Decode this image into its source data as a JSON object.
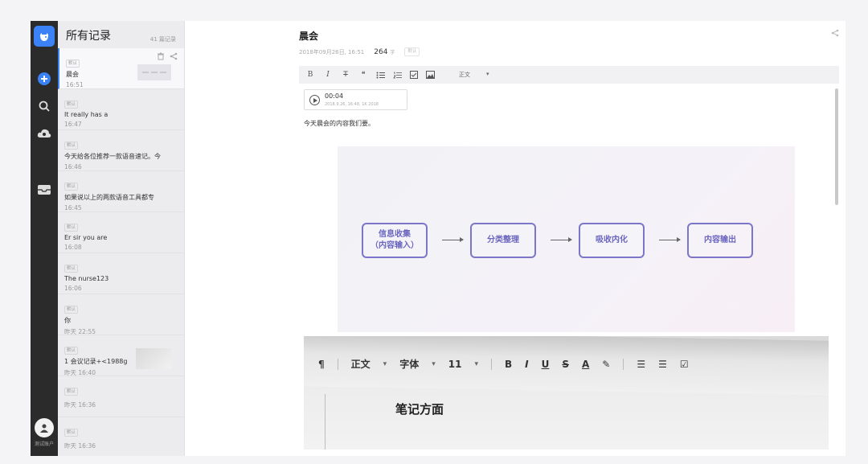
{
  "rail": {
    "avatar_label": "测试账户"
  },
  "list": {
    "title": "所有记录",
    "count": "41 篇记录",
    "items": [
      {
        "tag": "默认",
        "title": "晨会",
        "time": "16:51"
      },
      {
        "tag": "默认",
        "title": "It really has a",
        "time": "16:47"
      },
      {
        "tag": "默认",
        "title": "今天给各位推荐一款语音速记。今",
        "time": "16:46"
      },
      {
        "tag": "默认",
        "title": "如果说以上的两款语音工具都专",
        "time": "16:45"
      },
      {
        "tag": "默认",
        "title": "Er sir you are",
        "time": "16:08"
      },
      {
        "tag": "默认",
        "title": "The nurse123",
        "time": "16:06"
      },
      {
        "tag": "默认",
        "title": "你",
        "time": "昨天 22:55"
      },
      {
        "tag": "默认",
        "title": "1 会议记录+<1988g",
        "time": "昨天 16:40"
      },
      {
        "tag": "默认",
        "title": "",
        "time": "昨天 16:36"
      },
      {
        "tag": "默认",
        "title": "",
        "time": "昨天 16:36"
      }
    ]
  },
  "editor": {
    "title": "晨会",
    "date": "2018年09月26日, 16:51",
    "word_count": "264",
    "word_unit": "字",
    "tag": "默认",
    "toolbar": {
      "bold": "B",
      "italic": "I",
      "strike": "T",
      "quote": "❝",
      "style": "正文",
      "style_caret": "▾"
    },
    "audio": {
      "duration": "00:04",
      "stamp": "2018.9.26, 16:48, 1K 2018"
    },
    "paragraph": "今天晨会的内容我们要。",
    "flow": [
      "信息收集\n（内容输入）",
      "分类整理",
      "吸收内化",
      "内容输出"
    ],
    "photo": {
      "style": "正文",
      "font": "字体",
      "size": "11",
      "bold": "B",
      "italic": "I",
      "underline": "U",
      "strike": "S",
      "color": "A",
      "heading": "笔记方面"
    }
  }
}
